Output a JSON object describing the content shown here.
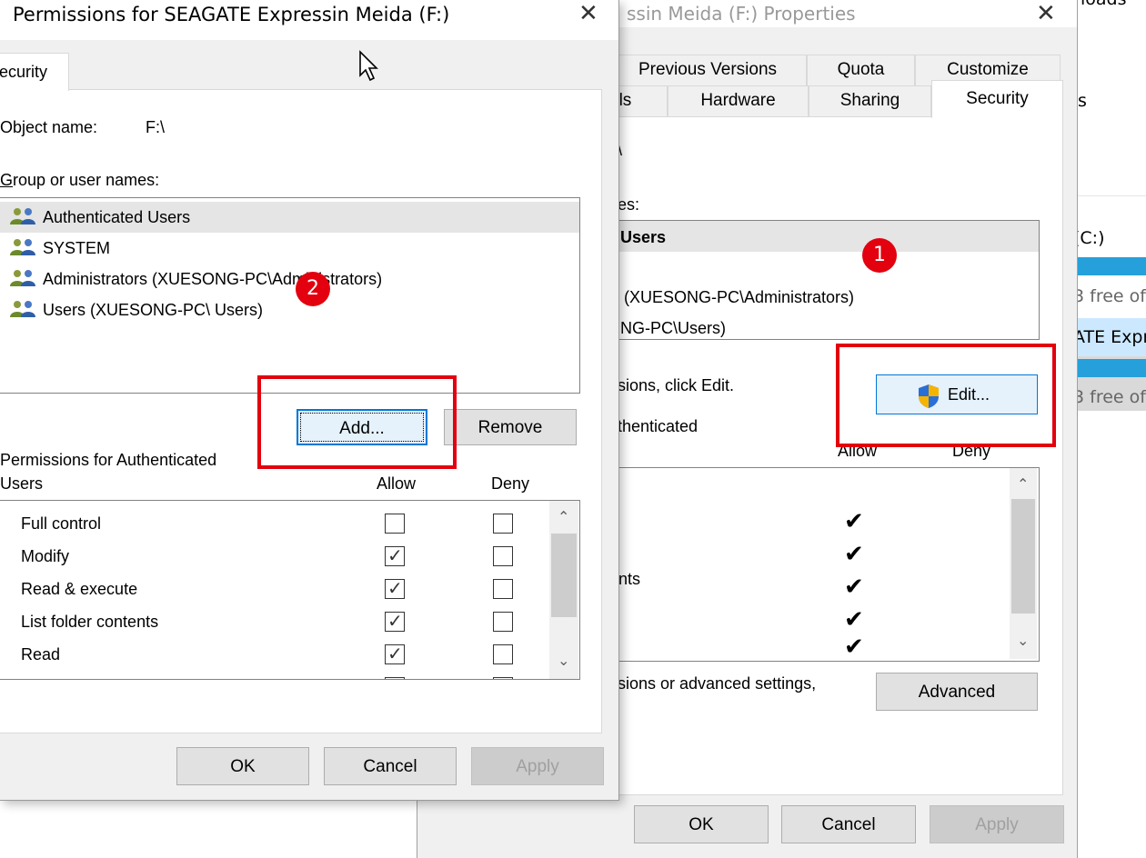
{
  "explorer": {
    "header_text": "loads",
    "top_frag": "s",
    "drive_c": "(C:)",
    "drive_c_free": "3 free of",
    "drive_f": "ATE Expr",
    "drive_f_free": "3 free of"
  },
  "properties": {
    "title": "ssin Meida (F:) Properties",
    "tabs_row1": [
      "Previous Versions",
      "Quota",
      "Customize"
    ],
    "tabs_row2": [
      "ols",
      "Hardware",
      "Sharing",
      "Security"
    ],
    "object_frag": "\\",
    "group_label_frag": "es:",
    "users": [
      "Users",
      "",
      "(XUESONG-PC\\Administrators)",
      "NG-PC\\Users)"
    ],
    "edit_hint": "sions, click Edit.",
    "edit_button": "Edit...",
    "perm_for_frag": "thenticated",
    "allow_header": "Allow",
    "deny_header": "Deny",
    "perm_frag": "nts",
    "allow_checks": [
      true,
      true,
      true,
      true,
      true
    ],
    "advanced_hint": "sions or advanced settings,",
    "advanced_button": "Advanced",
    "ok": "OK",
    "cancel": "Cancel",
    "apply": "Apply"
  },
  "permissions": {
    "title": "Permissions for SEAGATE Expressin Meida (F:)",
    "tab": "ecurity",
    "object_label": "Object name:",
    "object_value": "F:\\",
    "group_label": "Group or user names:",
    "users": [
      "Authenticated Users",
      "SYSTEM",
      "Administrators (XUESONG-PC\\Administrators)",
      "Users (XUESONG-PC\\ Users)"
    ],
    "add_button": "Add...",
    "remove_button": "Remove",
    "perm_label_line1": "Permissions for Authenticated",
    "perm_label_line2": "Users",
    "allow_header": "Allow",
    "deny_header": "Deny",
    "rows": [
      {
        "name": "Full control",
        "allow": false,
        "deny": false
      },
      {
        "name": "Modify",
        "allow": true,
        "deny": false
      },
      {
        "name": "Read & execute",
        "allow": true,
        "deny": false
      },
      {
        "name": "List folder contents",
        "allow": true,
        "deny": false
      },
      {
        "name": "Read",
        "allow": true,
        "deny": false
      }
    ],
    "ok": "OK",
    "cancel": "Cancel",
    "apply": "Apply"
  },
  "annotations": {
    "badge1": "1",
    "badge2": "2",
    "highlight_color": "#e3000f"
  }
}
